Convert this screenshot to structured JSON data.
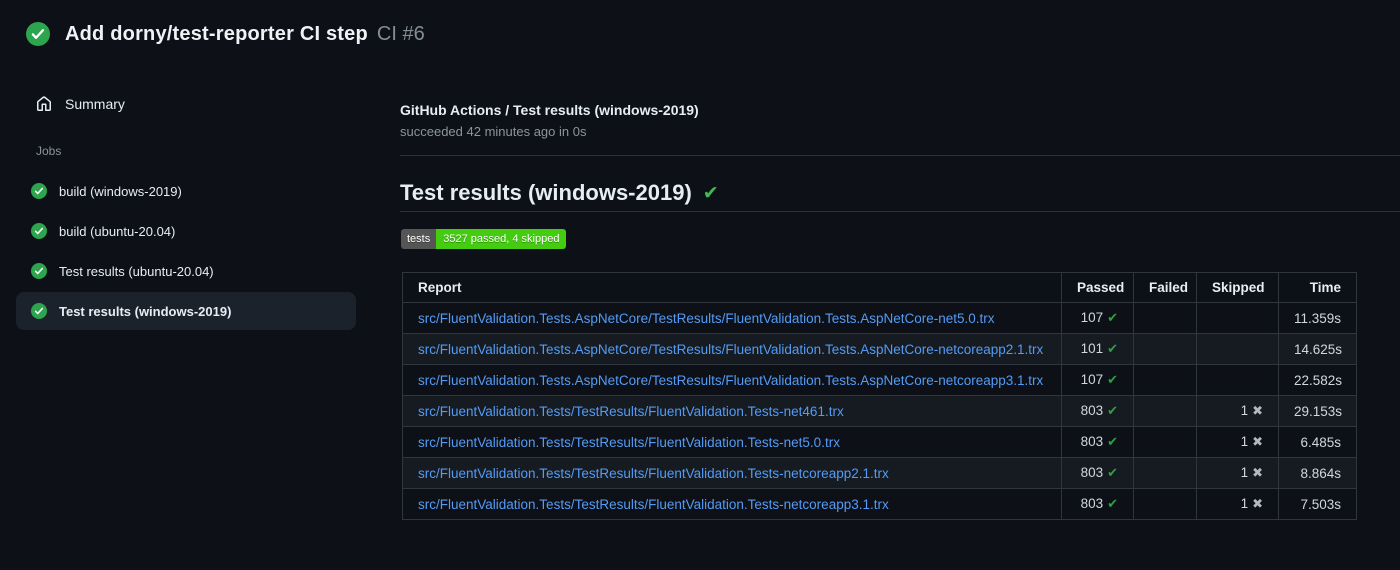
{
  "colors": {
    "background": "#0d1117",
    "row_alt": "#161b22",
    "table_border": "#30363d",
    "link_blue": "#539bf5",
    "success_green": "#2da44e",
    "check_green": "#3fb950",
    "skipped_gray": "#b1bac4",
    "badge_label_bg": "#555555",
    "badge_value_bg": "#44cc11",
    "selected_item_bg": "#1c222b",
    "muted_text": "#8b949e"
  },
  "run_header": {
    "status_icon": "check-circle-icon",
    "title": "Add dorny/test-reporter CI step",
    "run_number": "CI #6"
  },
  "sidebar": {
    "summary_label": "Summary",
    "summary_icon": "home-icon",
    "jobs_section_label": "Jobs",
    "jobs": [
      {
        "label": "build (windows-2019)",
        "status": "success",
        "selected": false
      },
      {
        "label": "build (ubuntu-20.04)",
        "status": "success",
        "selected": false
      },
      {
        "label": "Test results (ubuntu-20.04)",
        "status": "success",
        "selected": false
      },
      {
        "label": "Test results (windows-2019)",
        "status": "success",
        "selected": true
      }
    ]
  },
  "main": {
    "job_header_title": "GitHub Actions / Test results (windows-2019)",
    "job_header_status": "succeeded 42 minutes ago in 0s",
    "report_heading": "Test results (windows-2019)",
    "heading_check_glyph": "✔",
    "badge": {
      "label": "tests",
      "value": "3527 passed, 4 skipped"
    },
    "table": {
      "columns": [
        "Report",
        "Passed",
        "Failed",
        "Skipped",
        "Time"
      ],
      "check_glyph": "✔",
      "skip_glyph": "✖",
      "rows": [
        {
          "report": "src/FluentValidation.Tests.AspNetCore/TestResults/FluentValidation.Tests.AspNetCore-net5.0.trx",
          "passed": "107",
          "failed": "",
          "skipped": "",
          "time": "11.359s"
        },
        {
          "report": "src/FluentValidation.Tests.AspNetCore/TestResults/FluentValidation.Tests.AspNetCore-netcoreapp2.1.trx",
          "passed": "101",
          "failed": "",
          "skipped": "",
          "time": "14.625s"
        },
        {
          "report": "src/FluentValidation.Tests.AspNetCore/TestResults/FluentValidation.Tests.AspNetCore-netcoreapp3.1.trx",
          "passed": "107",
          "failed": "",
          "skipped": "",
          "time": "22.582s"
        },
        {
          "report": "src/FluentValidation.Tests/TestResults/FluentValidation.Tests-net461.trx",
          "passed": "803",
          "failed": "",
          "skipped": "1",
          "time": "29.153s"
        },
        {
          "report": "src/FluentValidation.Tests/TestResults/FluentValidation.Tests-net5.0.trx",
          "passed": "803",
          "failed": "",
          "skipped": "1",
          "time": "6.485s"
        },
        {
          "report": "src/FluentValidation.Tests/TestResults/FluentValidation.Tests-netcoreapp2.1.trx",
          "passed": "803",
          "failed": "",
          "skipped": "1",
          "time": "8.864s"
        },
        {
          "report": "src/FluentValidation.Tests/TestResults/FluentValidation.Tests-netcoreapp3.1.trx",
          "passed": "803",
          "failed": "",
          "skipped": "1",
          "time": "7.503s"
        }
      ]
    }
  }
}
